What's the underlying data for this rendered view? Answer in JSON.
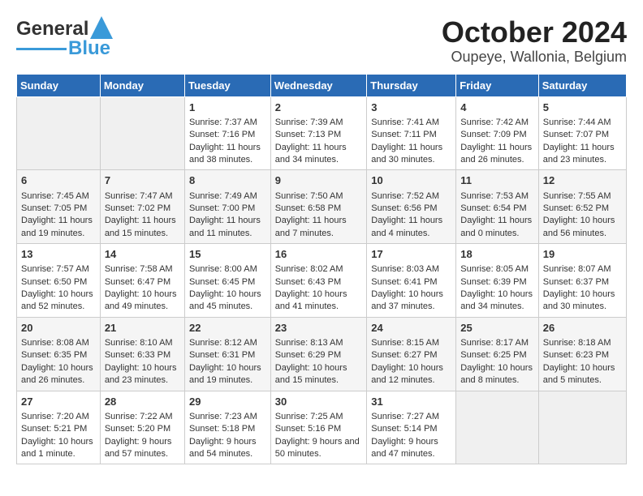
{
  "header": {
    "logo_line1": "General",
    "logo_line2": "Blue",
    "title": "October 2024",
    "subtitle": "Oupeye, Wallonia, Belgium"
  },
  "days_of_week": [
    "Sunday",
    "Monday",
    "Tuesday",
    "Wednesday",
    "Thursday",
    "Friday",
    "Saturday"
  ],
  "weeks": [
    [
      {
        "day": "",
        "content": ""
      },
      {
        "day": "",
        "content": ""
      },
      {
        "day": "1",
        "content": "Sunrise: 7:37 AM\nSunset: 7:16 PM\nDaylight: 11 hours and 38 minutes."
      },
      {
        "day": "2",
        "content": "Sunrise: 7:39 AM\nSunset: 7:13 PM\nDaylight: 11 hours and 34 minutes."
      },
      {
        "day": "3",
        "content": "Sunrise: 7:41 AM\nSunset: 7:11 PM\nDaylight: 11 hours and 30 minutes."
      },
      {
        "day": "4",
        "content": "Sunrise: 7:42 AM\nSunset: 7:09 PM\nDaylight: 11 hours and 26 minutes."
      },
      {
        "day": "5",
        "content": "Sunrise: 7:44 AM\nSunset: 7:07 PM\nDaylight: 11 hours and 23 minutes."
      }
    ],
    [
      {
        "day": "6",
        "content": "Sunrise: 7:45 AM\nSunset: 7:05 PM\nDaylight: 11 hours and 19 minutes."
      },
      {
        "day": "7",
        "content": "Sunrise: 7:47 AM\nSunset: 7:02 PM\nDaylight: 11 hours and 15 minutes."
      },
      {
        "day": "8",
        "content": "Sunrise: 7:49 AM\nSunset: 7:00 PM\nDaylight: 11 hours and 11 minutes."
      },
      {
        "day": "9",
        "content": "Sunrise: 7:50 AM\nSunset: 6:58 PM\nDaylight: 11 hours and 7 minutes."
      },
      {
        "day": "10",
        "content": "Sunrise: 7:52 AM\nSunset: 6:56 PM\nDaylight: 11 hours and 4 minutes."
      },
      {
        "day": "11",
        "content": "Sunrise: 7:53 AM\nSunset: 6:54 PM\nDaylight: 11 hours and 0 minutes."
      },
      {
        "day": "12",
        "content": "Sunrise: 7:55 AM\nSunset: 6:52 PM\nDaylight: 10 hours and 56 minutes."
      }
    ],
    [
      {
        "day": "13",
        "content": "Sunrise: 7:57 AM\nSunset: 6:50 PM\nDaylight: 10 hours and 52 minutes."
      },
      {
        "day": "14",
        "content": "Sunrise: 7:58 AM\nSunset: 6:47 PM\nDaylight: 10 hours and 49 minutes."
      },
      {
        "day": "15",
        "content": "Sunrise: 8:00 AM\nSunset: 6:45 PM\nDaylight: 10 hours and 45 minutes."
      },
      {
        "day": "16",
        "content": "Sunrise: 8:02 AM\nSunset: 6:43 PM\nDaylight: 10 hours and 41 minutes."
      },
      {
        "day": "17",
        "content": "Sunrise: 8:03 AM\nSunset: 6:41 PM\nDaylight: 10 hours and 37 minutes."
      },
      {
        "day": "18",
        "content": "Sunrise: 8:05 AM\nSunset: 6:39 PM\nDaylight: 10 hours and 34 minutes."
      },
      {
        "day": "19",
        "content": "Sunrise: 8:07 AM\nSunset: 6:37 PM\nDaylight: 10 hours and 30 minutes."
      }
    ],
    [
      {
        "day": "20",
        "content": "Sunrise: 8:08 AM\nSunset: 6:35 PM\nDaylight: 10 hours and 26 minutes."
      },
      {
        "day": "21",
        "content": "Sunrise: 8:10 AM\nSunset: 6:33 PM\nDaylight: 10 hours and 23 minutes."
      },
      {
        "day": "22",
        "content": "Sunrise: 8:12 AM\nSunset: 6:31 PM\nDaylight: 10 hours and 19 minutes."
      },
      {
        "day": "23",
        "content": "Sunrise: 8:13 AM\nSunset: 6:29 PM\nDaylight: 10 hours and 15 minutes."
      },
      {
        "day": "24",
        "content": "Sunrise: 8:15 AM\nSunset: 6:27 PM\nDaylight: 10 hours and 12 minutes."
      },
      {
        "day": "25",
        "content": "Sunrise: 8:17 AM\nSunset: 6:25 PM\nDaylight: 10 hours and 8 minutes."
      },
      {
        "day": "26",
        "content": "Sunrise: 8:18 AM\nSunset: 6:23 PM\nDaylight: 10 hours and 5 minutes."
      }
    ],
    [
      {
        "day": "27",
        "content": "Sunrise: 7:20 AM\nSunset: 5:21 PM\nDaylight: 10 hours and 1 minute."
      },
      {
        "day": "28",
        "content": "Sunrise: 7:22 AM\nSunset: 5:20 PM\nDaylight: 9 hours and 57 minutes."
      },
      {
        "day": "29",
        "content": "Sunrise: 7:23 AM\nSunset: 5:18 PM\nDaylight: 9 hours and 54 minutes."
      },
      {
        "day": "30",
        "content": "Sunrise: 7:25 AM\nSunset: 5:16 PM\nDaylight: 9 hours and 50 minutes."
      },
      {
        "day": "31",
        "content": "Sunrise: 7:27 AM\nSunset: 5:14 PM\nDaylight: 9 hours and 47 minutes."
      },
      {
        "day": "",
        "content": ""
      },
      {
        "day": "",
        "content": ""
      }
    ]
  ]
}
